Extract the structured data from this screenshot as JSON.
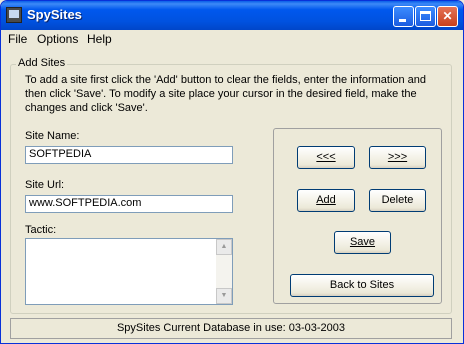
{
  "window": {
    "title": "SpySites"
  },
  "menu": {
    "items": [
      "File",
      "Options",
      "Help"
    ]
  },
  "group": {
    "legend": "Add Sites",
    "intro": "To add a site first click the 'Add' button to clear the fields, enter the information and then click 'Save'.  To modify a site place your cursor in the desired field, make the changes and click 'Save'."
  },
  "form": {
    "site_name_label": "Site Name:",
    "site_name_value": "SOFTPEDIA",
    "site_url_label": "Site Url:",
    "site_url_value": "www.SOFTPEDIA.com",
    "tactic_label": "Tactic:",
    "tactic_value": ""
  },
  "buttons": {
    "prev": "<<<",
    "next": ">>>",
    "add": "Add",
    "delete": "Delete",
    "save": "Save",
    "back": "Back to Sites"
  },
  "status": {
    "text": "SpySites Current Database in use:  03-03-2003"
  }
}
